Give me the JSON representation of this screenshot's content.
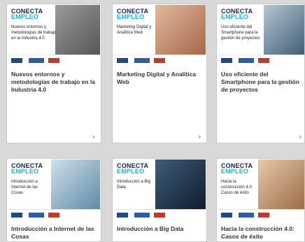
{
  "cards": [
    {
      "brand_top": "CONECTA",
      "brand_bottom": "EMPLEO",
      "thumb_text": "Nuevos entornos y metodologías de trabajo en la Industria 4.0",
      "title": "Nuevos entornos y metodologías de trabajo en la Industria 4.0",
      "chevron": "›",
      "photo_color": "#7a7a7a"
    },
    {
      "brand_top": "CONECTA",
      "brand_bottom": "EMPLEO",
      "thumb_text": "Marketing Digital y Analítica Web",
      "title": "Marketing Digital y Analítica Web",
      "chevron": "›",
      "photo_color": "#c98a6a"
    },
    {
      "brand_top": "CONECTA",
      "brand_bottom": "EMPLEO",
      "thumb_text": "Uso eficiente del Smartphone para la gestión de proyectos",
      "title": "Uso eficiente del Smartphone para la gestión de proyectos",
      "chevron": "›",
      "photo_color": "#6e8fa6"
    },
    {
      "brand_top": "CONECTA",
      "brand_bottom": "EMPLEO",
      "thumb_text": "Introducción a Internet de las Cosas",
      "title": "Introducción a Internet de las Cosas",
      "photo_color": "#8bb0c8"
    },
    {
      "brand_top": "CONECTA",
      "brand_bottom": "EMPLEO",
      "thumb_text": "Introducción a Big Data",
      "title": "Introducción a Big Data",
      "photo_color": "#22384e"
    },
    {
      "brand_top": "CONECTA",
      "brand_bottom": "EMPLEO",
      "thumb_text": "Hacia la construcción 4.0: Casos de éxito",
      "title": "Hacia la construcción 4.0: Casos de éxito",
      "photo_color": "#c99c76"
    }
  ]
}
